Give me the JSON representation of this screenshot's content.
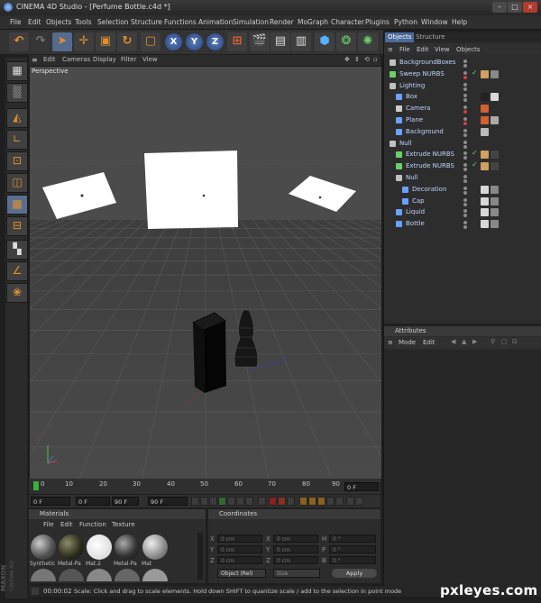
{
  "window": {
    "title": "CINEMA 4D Studio - [Perfume Bottle.c4d *]"
  },
  "menubar": [
    "File",
    "Edit",
    "Objects",
    "Tools",
    "Selection",
    "Structure",
    "Functions",
    "Animation",
    "Simulation",
    "Render",
    "MoGraph",
    "Character",
    "Plugins",
    "Python",
    "Window",
    "Help"
  ],
  "toolbar": {
    "axes": [
      "X",
      "Y",
      "Z"
    ]
  },
  "viewport": {
    "menu": [
      "Edit",
      "Cameras",
      "Display",
      "Filter",
      "View"
    ],
    "label": "Perspective"
  },
  "timeline": {
    "ticks": [
      "0",
      "10",
      "20",
      "30",
      "40",
      "50",
      "60",
      "70",
      "80",
      "90"
    ],
    "end_field": "0 F"
  },
  "playback": {
    "current": "0 F",
    "min": "0 F",
    "max": "90 F",
    "end": "90 F"
  },
  "materials": {
    "title": "Materials",
    "menu": [
      "File",
      "Edit",
      "Function",
      "Texture"
    ],
    "items": [
      "Synthetic",
      "Metal-Pa",
      "Mat.2",
      "Metal-Pa",
      "Mat"
    ]
  },
  "coordinates": {
    "title": "Coordinates",
    "rows": [
      {
        "a": "X",
        "av": "0 cm",
        "b": "X",
        "bv": "0 cm",
        "c": "H",
        "cv": "0 °"
      },
      {
        "a": "Y",
        "av": "0 cm",
        "b": "Y",
        "bv": "0 cm",
        "c": "P",
        "cv": "0 °"
      },
      {
        "a": "Z",
        "av": "0 cm",
        "b": "Z",
        "bv": "0 cm",
        "c": "B",
        "cv": "0 °"
      }
    ],
    "mode": "Object (Rel)",
    "size": "Size",
    "apply": "Apply"
  },
  "object_manager": {
    "tabs": [
      "Objects",
      "Structure"
    ],
    "menu": [
      "File",
      "Edit",
      "View",
      "Objects"
    ],
    "items": [
      {
        "name": "BackgroundBoxes",
        "indent": 0
      },
      {
        "name": "Sweep NURBS",
        "indent": 0
      },
      {
        "name": "Lighting",
        "indent": 0
      },
      {
        "name": "Box",
        "indent": 1
      },
      {
        "name": "Camera",
        "indent": 1
      },
      {
        "name": "Plane",
        "indent": 1
      },
      {
        "name": "Background",
        "indent": 1
      },
      {
        "name": "Null",
        "indent": 0
      },
      {
        "name": "Extrude NURBS",
        "indent": 1
      },
      {
        "name": "Extrude NURBS",
        "indent": 1
      },
      {
        "name": "Null",
        "indent": 1
      },
      {
        "name": "Decoration",
        "indent": 2
      },
      {
        "name": "Cap",
        "indent": 2
      },
      {
        "name": "Liquid",
        "indent": 1
      },
      {
        "name": "Bottle",
        "indent": 1
      }
    ]
  },
  "attributes": {
    "title": "Attributes",
    "menu": [
      "Mode",
      "Edit"
    ]
  },
  "status": {
    "time": "00:00:02",
    "message": "Scale: Click and drag to scale elements. Hold down SHIFT to quantize scale / add to the selection in point mode"
  },
  "branding": {
    "maxon": "MAXON CINEMA 4D",
    "watermark": "pxleyes.com"
  },
  "colors": {
    "accent_orange": "#e09030",
    "object_text": "#c0d4ff",
    "viewport_bg": "#4b4b4b"
  }
}
